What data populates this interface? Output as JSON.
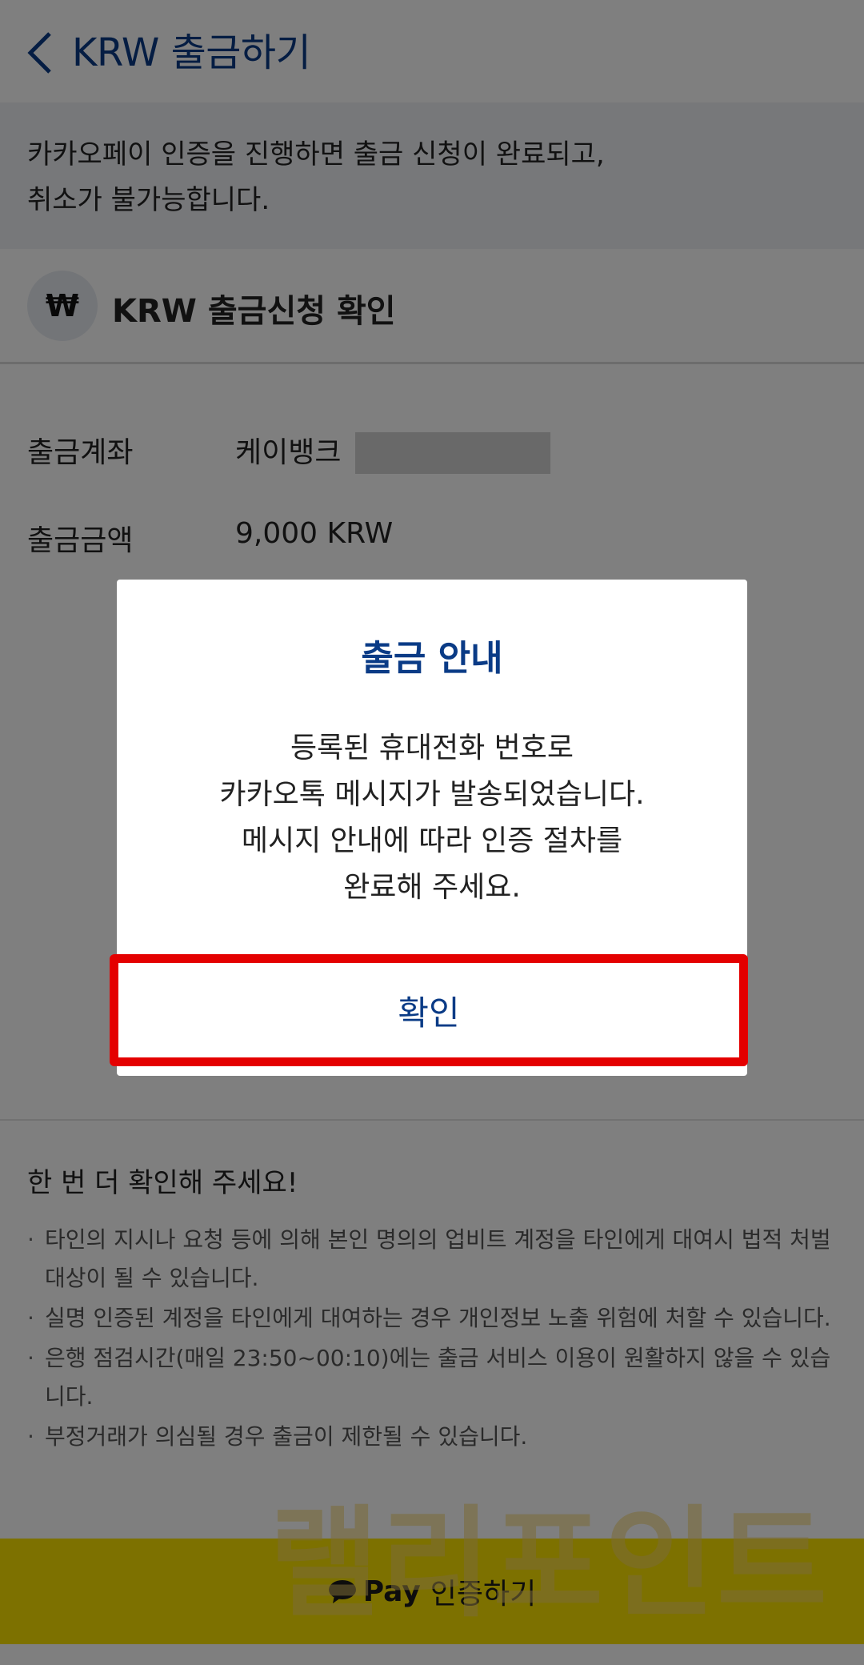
{
  "header": {
    "back_icon": "chevron-left-icon",
    "title": "KRW 출금하기"
  },
  "notice": {
    "line1": "카카오페이 인증을 진행하면 출금 신청이 완료되고,",
    "line2": "취소가 불가능합니다."
  },
  "section": {
    "icon_symbol": "₩",
    "title": "KRW 출금신청 확인"
  },
  "details": {
    "account_label": "출금계좌",
    "account_value": "케이뱅크",
    "amount_label": "출금금액",
    "amount_value": "9,000 KRW"
  },
  "caution": {
    "title": "한 번 더 확인해 주세요!",
    "items": [
      "타인의 지시나 요청 등에 의해 본인 명의의 업비트 계정을 타인에게 대여시 법적 처벌 대상이 될 수 있습니다.",
      "실명 인증된 계정을 타인에게 대여하는 경우 개인정보 노출 위험에 처할 수 있습니다.",
      "은행 점검시간(매일 23:50~00:10)에는 출금 서비스 이용이 원활하지 않을 수 있습니다.",
      "부정거래가 의심될 경우 출금이 제한될 수 있습니다."
    ]
  },
  "kakao": {
    "pay_label": "Pay",
    "action_label": "인증하기",
    "color": "#fbe200"
  },
  "watermark": "랠리포인트",
  "dialog": {
    "title": "출금 안내",
    "line1": "등록된 휴대전화 번호로",
    "line2": "카카오톡 메시지가 발송되었습니다.",
    "line3": "메시지 안내에 따라 인증 절차를",
    "line4": "완료해 주세요.",
    "confirm_label": "확인"
  },
  "colors": {
    "accent": "#0a3b86",
    "highlight": "#e40000"
  }
}
